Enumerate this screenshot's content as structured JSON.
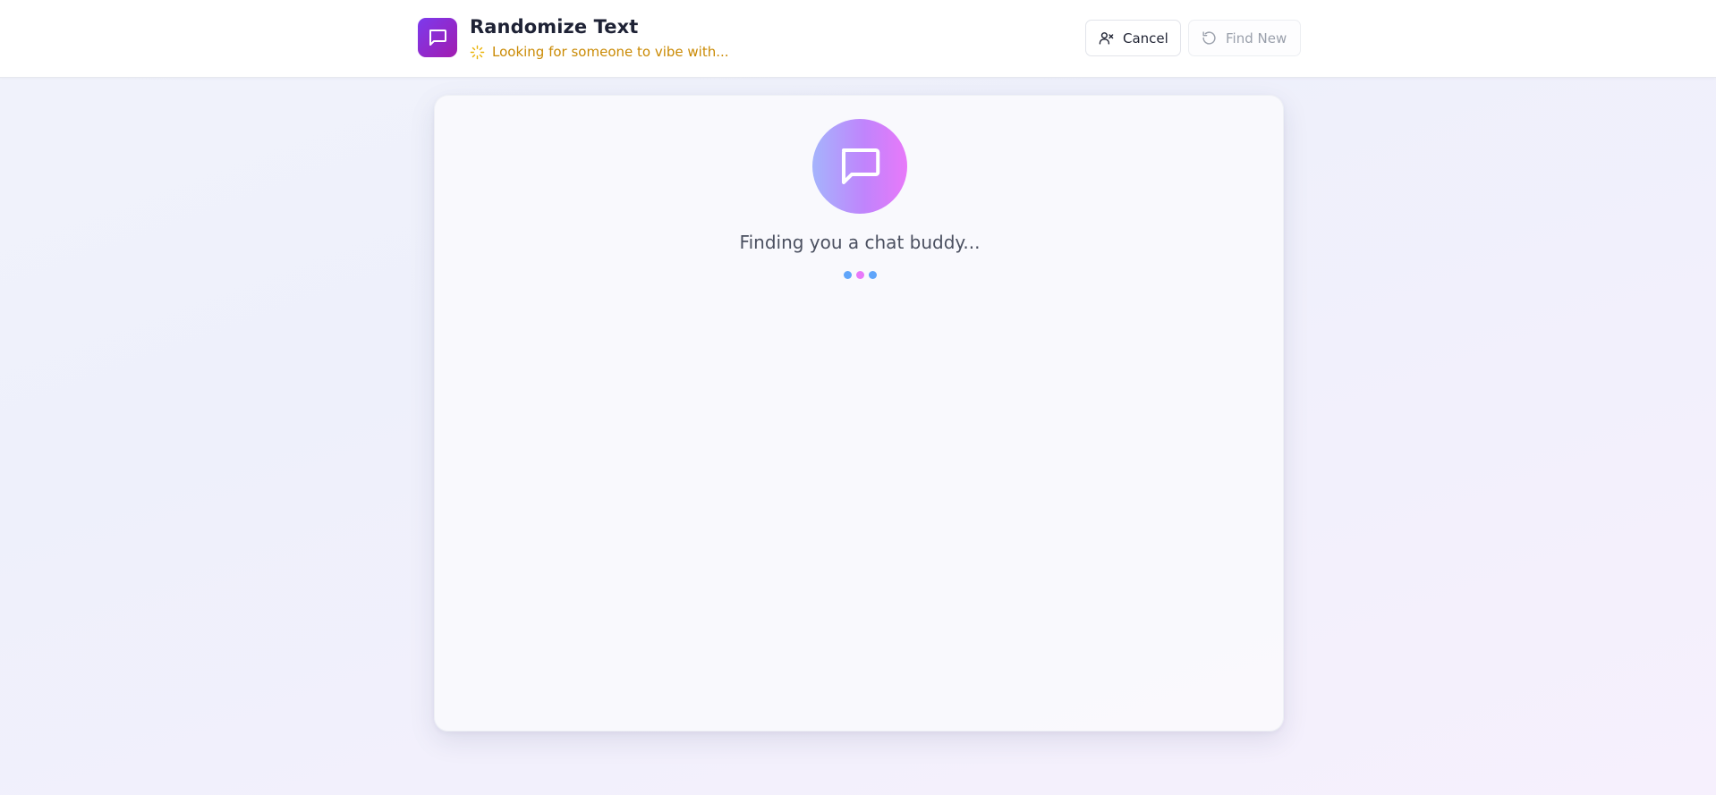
{
  "header": {
    "app_title": "Randomize Text",
    "status_text": "Looking for someone to vibe with...",
    "logo_icon": "chat-bubble-icon",
    "status_icon": "loader-icon",
    "brand_gradient": [
      "#7c3aed",
      "#a21caf"
    ],
    "status_color": "#ca8a04"
  },
  "toolbar": {
    "cancel_label": "Cancel",
    "cancel_icon": "user-x-icon",
    "find_new_label": "Find New",
    "find_new_icon": "refresh-icon",
    "find_new_disabled": true
  },
  "main": {
    "avatar_icon": "chat-bubble-icon",
    "finding_text": "Finding you a chat buddy...",
    "loading_dot_colors": [
      "#60a5fa",
      "#e879f9",
      "#60a5fa"
    ]
  }
}
